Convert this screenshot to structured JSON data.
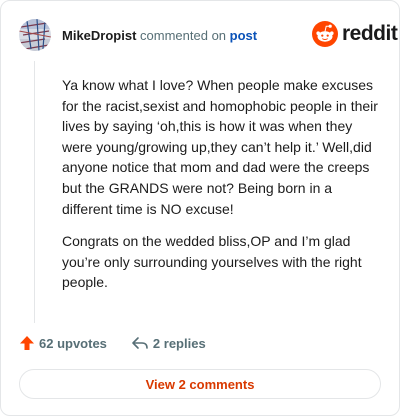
{
  "header": {
    "username": "MikeDropist",
    "action_text": "commented on",
    "post_link": "post",
    "brand": "reddit"
  },
  "comment": {
    "paragraphs": [
      "Ya know what I love? When people make excuses for the racist,sexist and homophobic people in their lives by saying ‘oh,this is how it was when they were young/growing up,they can’t help it.’ Well,did anyone notice that mom and dad were the creeps but the GRANDS were not? Being born in a different time is NO excuse!",
      "Congrats on the wedded bliss,OP and I’m glad you’re only surrounding yourselves with the right people."
    ]
  },
  "footer": {
    "upvotes": "62 upvotes",
    "replies": "2 replies"
  },
  "actions": {
    "view_comments": "View 2 comments"
  },
  "colors": {
    "reddit_orange": "#ff4500",
    "link_blue": "#0a52b8",
    "view_button_text": "#d93900",
    "muted": "#576f76"
  },
  "icons": {
    "avatar": "avatar-image",
    "logo": "reddit-snoo-icon",
    "upvote": "upvote-arrow-icon",
    "reply": "reply-arrow-icon"
  }
}
